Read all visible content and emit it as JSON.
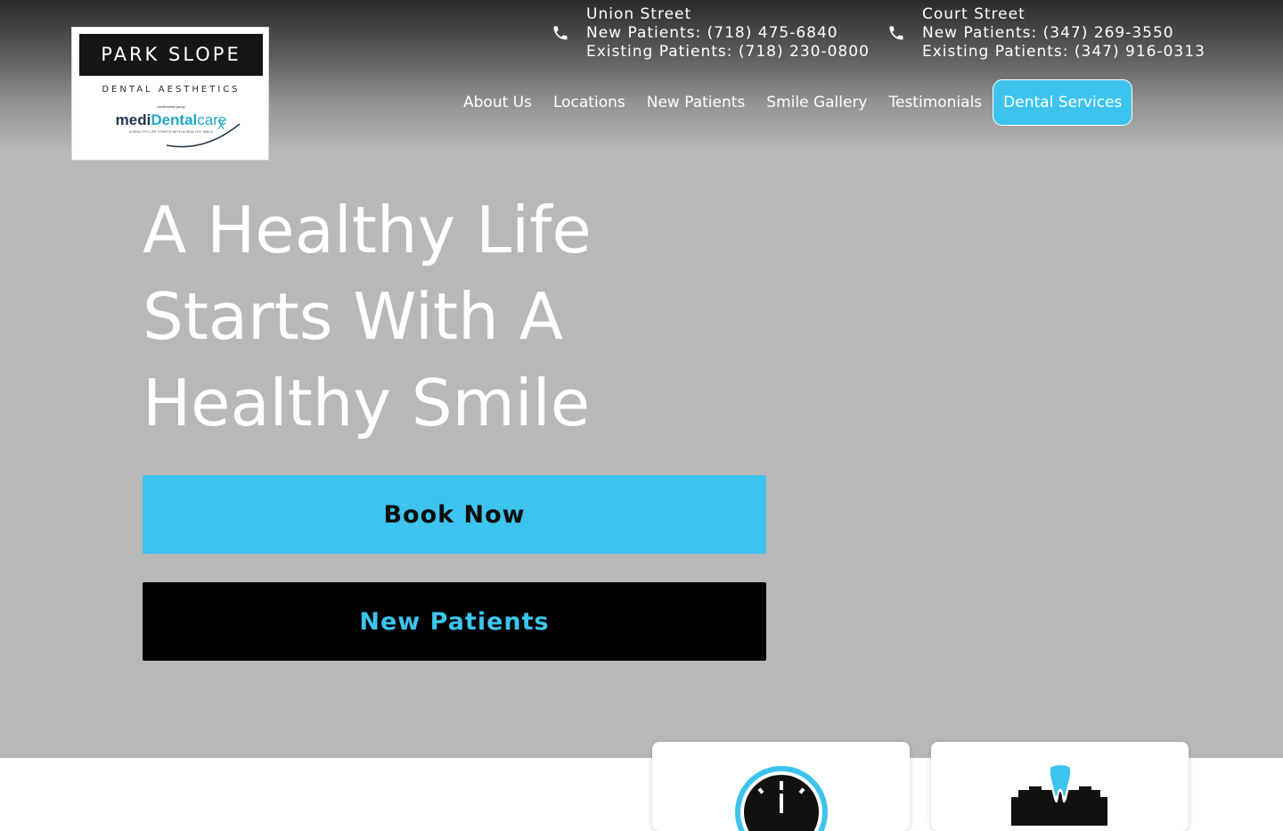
{
  "logo": {
    "title": "PARK SLOPE",
    "subtitle": "DENTAL AESTHETICS",
    "group": "mediDental group",
    "brand_part1": "medi",
    "brand_part2": "Dental",
    "brand_part3": "care",
    "tagline": "A HEALTHY LIFE STARTS WITH A HEALTHY SMILE"
  },
  "locations": [
    {
      "name": "Union Street",
      "new_patients": "New Patients: (718) 475-6840",
      "existing_patients": "Existing Patients: (718) 230-0800"
    },
    {
      "name": "Court Street",
      "new_patients": "New Patients: (347) 269-3550",
      "existing_patients": "Existing Patients: (347) 916-0313"
    }
  ],
  "nav": {
    "items": [
      {
        "label": "About Us"
      },
      {
        "label": "Locations"
      },
      {
        "label": "New Patients"
      },
      {
        "label": "Smile Gallery"
      },
      {
        "label": "Testimonials"
      },
      {
        "label": "Dental Services"
      }
    ],
    "active_item": "Dental Services"
  },
  "hero": {
    "headline_line1": "A Healthy Life",
    "headline_line2": "Starts With A",
    "headline_line3": "Healthy Smile",
    "book_button": "Book Now",
    "new_patients_button": "New Patients"
  },
  "cards": [
    {
      "icon": "clock-icon"
    },
    {
      "icon": "tooth-icon"
    }
  ],
  "colors": {
    "accent": "#3cc4ee",
    "hero_background": "#b8b8b8",
    "dark": "#000000",
    "text_light": "#ffffff"
  }
}
